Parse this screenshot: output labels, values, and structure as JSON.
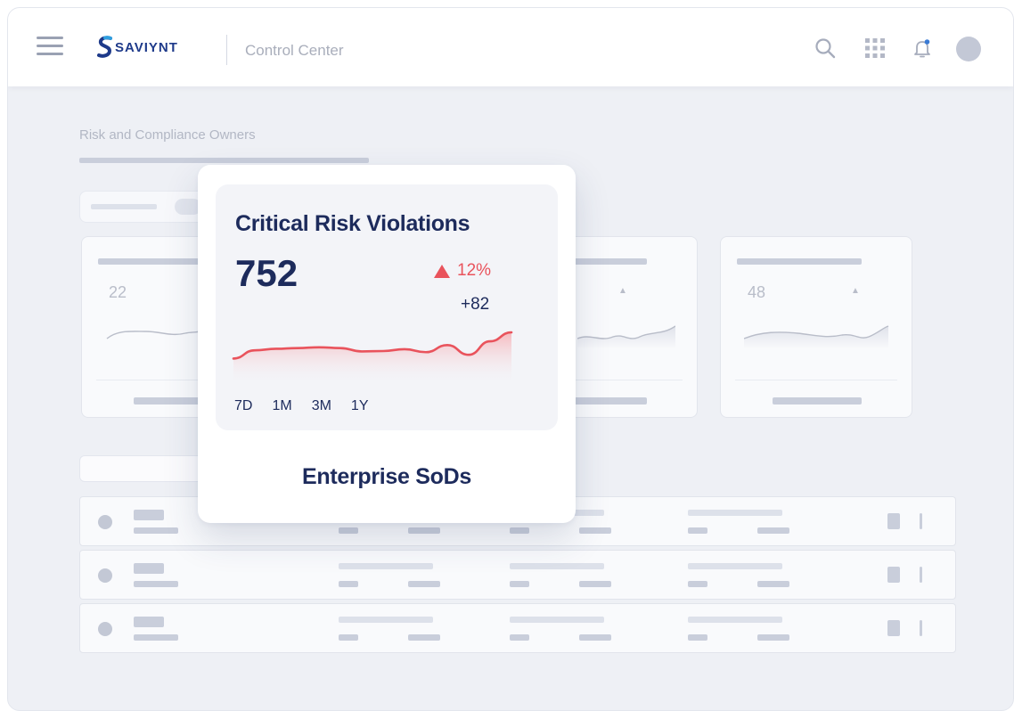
{
  "header": {
    "brand": "SAVIYNT",
    "app_title": "Control Center"
  },
  "page": {
    "label": "Risk and Compliance Owners"
  },
  "mini_cards": [
    {
      "value": "22"
    },
    {
      "value": ""
    },
    {
      "value": "48"
    }
  ],
  "focus_card": {
    "title": "Critical Risk Violations",
    "value": "752",
    "change_pct": "12%",
    "change_delta": "+82",
    "ranges": [
      "7D",
      "1M",
      "3M",
      "1Y"
    ],
    "footer": "Enterprise SoDs",
    "accent": "#e9535c",
    "trend_values": [
      0.3,
      0.52,
      0.56,
      0.58,
      0.6,
      0.58,
      0.49,
      0.5,
      0.55,
      0.47,
      0.66,
      0.4,
      0.76,
      1.0
    ]
  },
  "icons": {
    "menu": "hamburger-icon",
    "search": "search-icon",
    "apps": "grid-icon",
    "notifications": "bell-icon",
    "profile": "avatar"
  }
}
